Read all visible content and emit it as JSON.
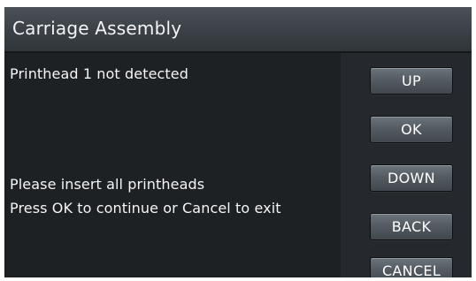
{
  "header": {
    "title": "Carriage Assembly"
  },
  "main": {
    "status_message": "Printhead 1 not detected",
    "instruction_line1": "Please insert all printheads",
    "instruction_line2": "Press OK to continue or Cancel to exit"
  },
  "buttons": {
    "up": "UP",
    "ok": "OK",
    "down": "DOWN",
    "back": "BACK",
    "cancel": "CANCEL"
  },
  "colors": {
    "background": "#1e2124",
    "title_bar": "#3a4046",
    "button": "#545b62",
    "text": "#f4f5f6"
  }
}
